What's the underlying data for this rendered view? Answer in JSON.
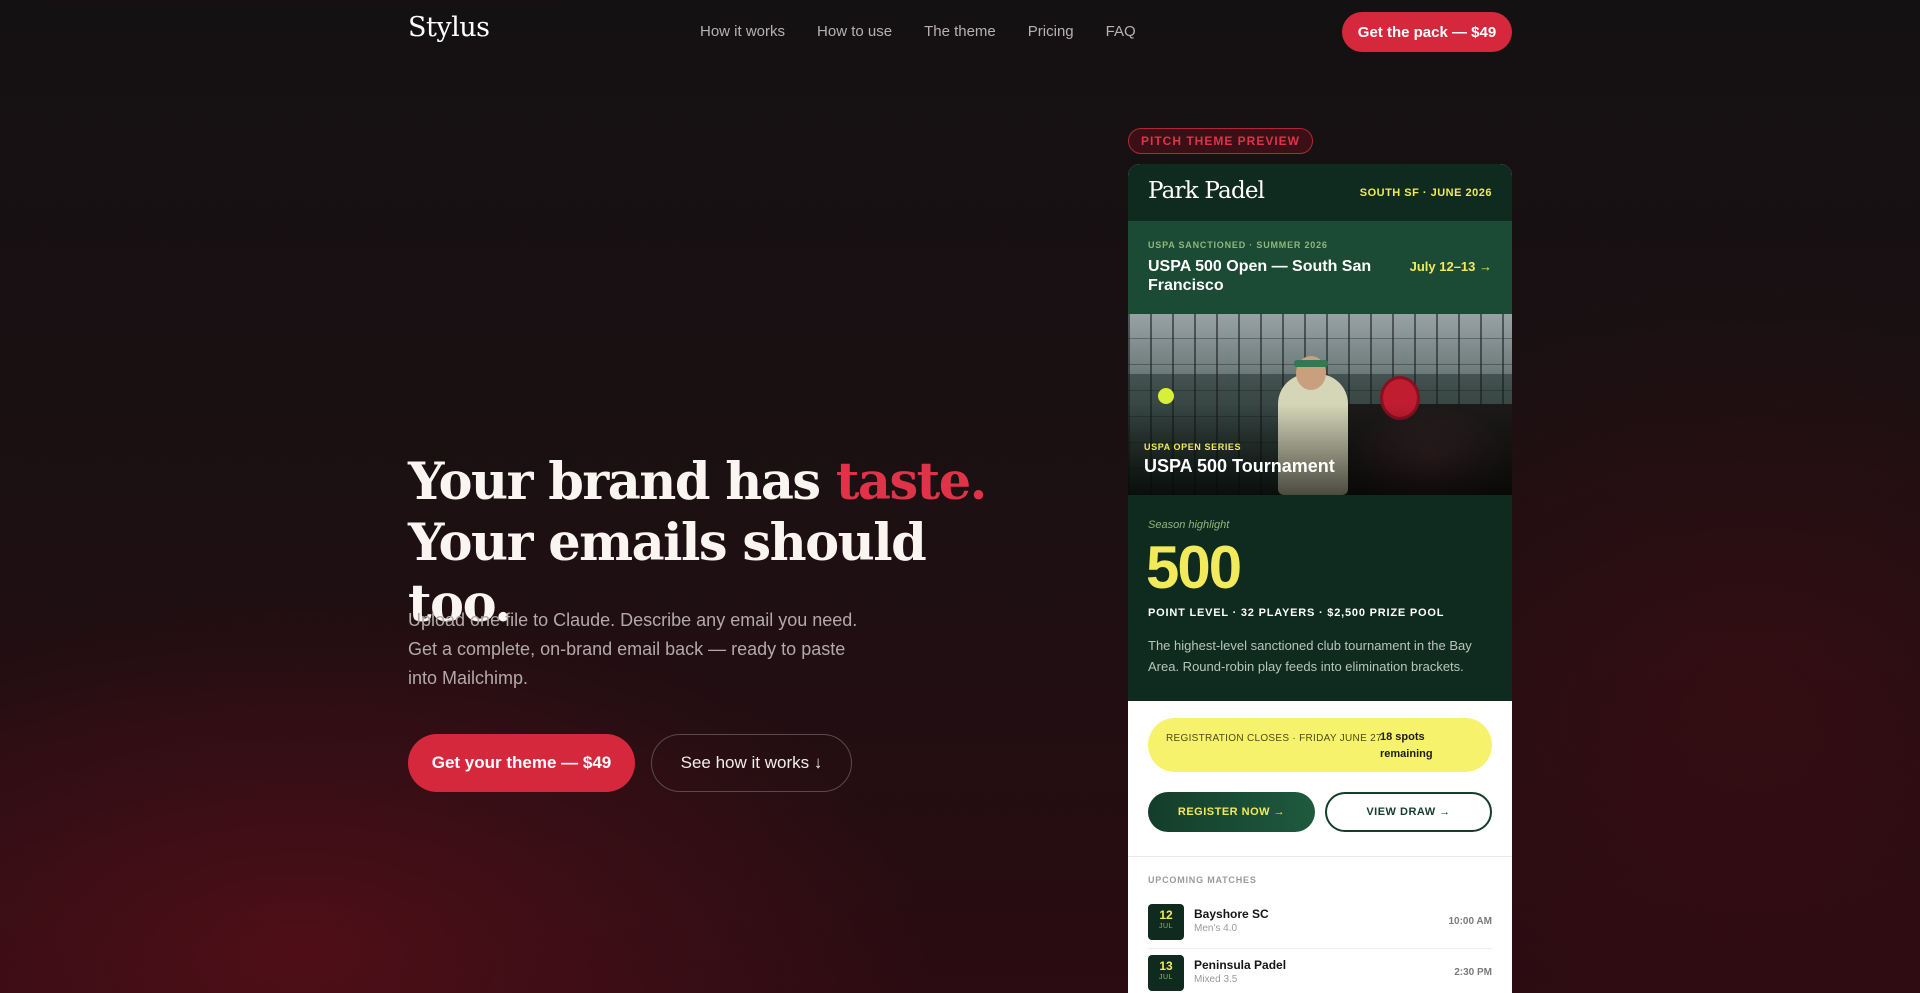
{
  "nav": {
    "logo": "Stylus",
    "links": [
      "How it works",
      "How to use",
      "The theme",
      "Pricing",
      "FAQ"
    ],
    "cta": "Get the pack — $49"
  },
  "hero": {
    "title_line1": "Your brand has ",
    "title_accent": "taste.",
    "title_line2": "Your emails should too.",
    "subtitle": "Upload one file to Claude. Describe any email you need. Get a complete, on-brand email back — ready to paste into Mailchimp.",
    "primary_button": "Get your theme — $49",
    "secondary_button": "See how it works ↓"
  },
  "preview": {
    "badge": "PITCH THEME PREVIEW",
    "brand": "Park Padel",
    "header_meta": "SOUTH SF · JUNE 2026",
    "event": {
      "kicker": "USPA SANCTIONED · SUMMER 2026",
      "title": "USPA 500 Open — South San Francisco",
      "dates": "July 12–13 →"
    },
    "photo": {
      "kicker": "USPA OPEN SERIES",
      "title": "USPA 500 Tournament"
    },
    "stat": {
      "label": "Season highlight",
      "number": "500",
      "line": "POINT LEVEL · 32 PLAYERS · $2,500 PRIZE POOL",
      "description": "The highest-level sanctioned club tournament in the Bay Area. Round-robin play feeds into elimination brackets."
    },
    "registration": {
      "left": "REGISTRATION CLOSES · FRIDAY JUNE 27",
      "right": "18 spots remaining"
    },
    "buttons": {
      "register": "REGISTER NOW →",
      "draw": "VIEW DRAW →"
    },
    "upcoming_title": "UPCOMING MATCHES",
    "matches": [
      {
        "day": "12",
        "month": "JUL",
        "name": "Bayshore SC",
        "level": "Men's 4.0",
        "time": "10:00 AM"
      },
      {
        "day": "13",
        "month": "JUL",
        "name": "Peninsula Padel",
        "level": "Mixed 3.5",
        "time": "2:30 PM"
      }
    ]
  },
  "colors": {
    "accent": "#d6283d",
    "pitch_green": "#0f2a1f",
    "pitch_yellow": "#f2ea5a"
  }
}
